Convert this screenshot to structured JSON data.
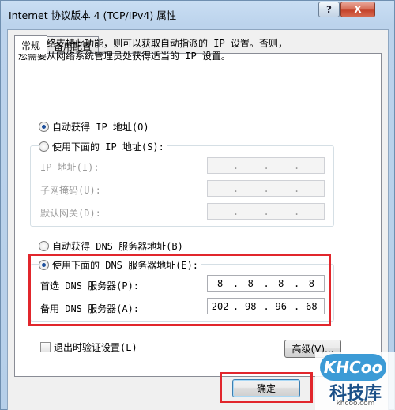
{
  "window": {
    "title": "Internet 协议版本 4 (TCP/IPv4) 属性",
    "help_label": "?",
    "close_label": "X"
  },
  "tabs": [
    {
      "label": "常规",
      "active": true
    },
    {
      "label": "备用配置",
      "active": false
    }
  ],
  "description": {
    "line1": "如果网络支持此功能，则可以获取自动指派的 IP 设置。否则，",
    "line2": "您需要从网络系统管理员处获得适当的 IP 设置。"
  },
  "ip_section": {
    "auto_label": "自动获得 IP 地址(O)",
    "auto_checked": true,
    "manual_label": "使用下面的 IP 地址(S):",
    "manual_checked": false,
    "fields": [
      {
        "label": "IP 地址(I):",
        "value": [
          "",
          "",
          "",
          ""
        ]
      },
      {
        "label": "子网掩码(U):",
        "value": [
          "",
          "",
          "",
          ""
        ]
      },
      {
        "label": "默认网关(D):",
        "value": [
          "",
          "",
          "",
          ""
        ]
      }
    ]
  },
  "dns_section": {
    "auto_label": "自动获得 DNS 服务器地址(B)",
    "auto_checked": false,
    "manual_label": "使用下面的 DNS 服务器地址(E):",
    "manual_checked": true,
    "preferred": {
      "label": "首选 DNS 服务器(P):",
      "value": [
        "8",
        "8",
        "8",
        "8"
      ]
    },
    "alternate": {
      "label": "备用 DNS 服务器(A):",
      "value": [
        "202",
        "98",
        "96",
        "68"
      ]
    }
  },
  "validate_on_exit": {
    "label": "退出时验证设置(L)",
    "checked": false
  },
  "advanced_button": "高级(V)...",
  "ok_button": "确定",
  "watermark": {
    "brand": "KHCoo",
    "name": "科技库",
    "url": "khcoo.com"
  },
  "colors": {
    "highlight": "#e1262c",
    "accent": "#3c9bd6"
  }
}
